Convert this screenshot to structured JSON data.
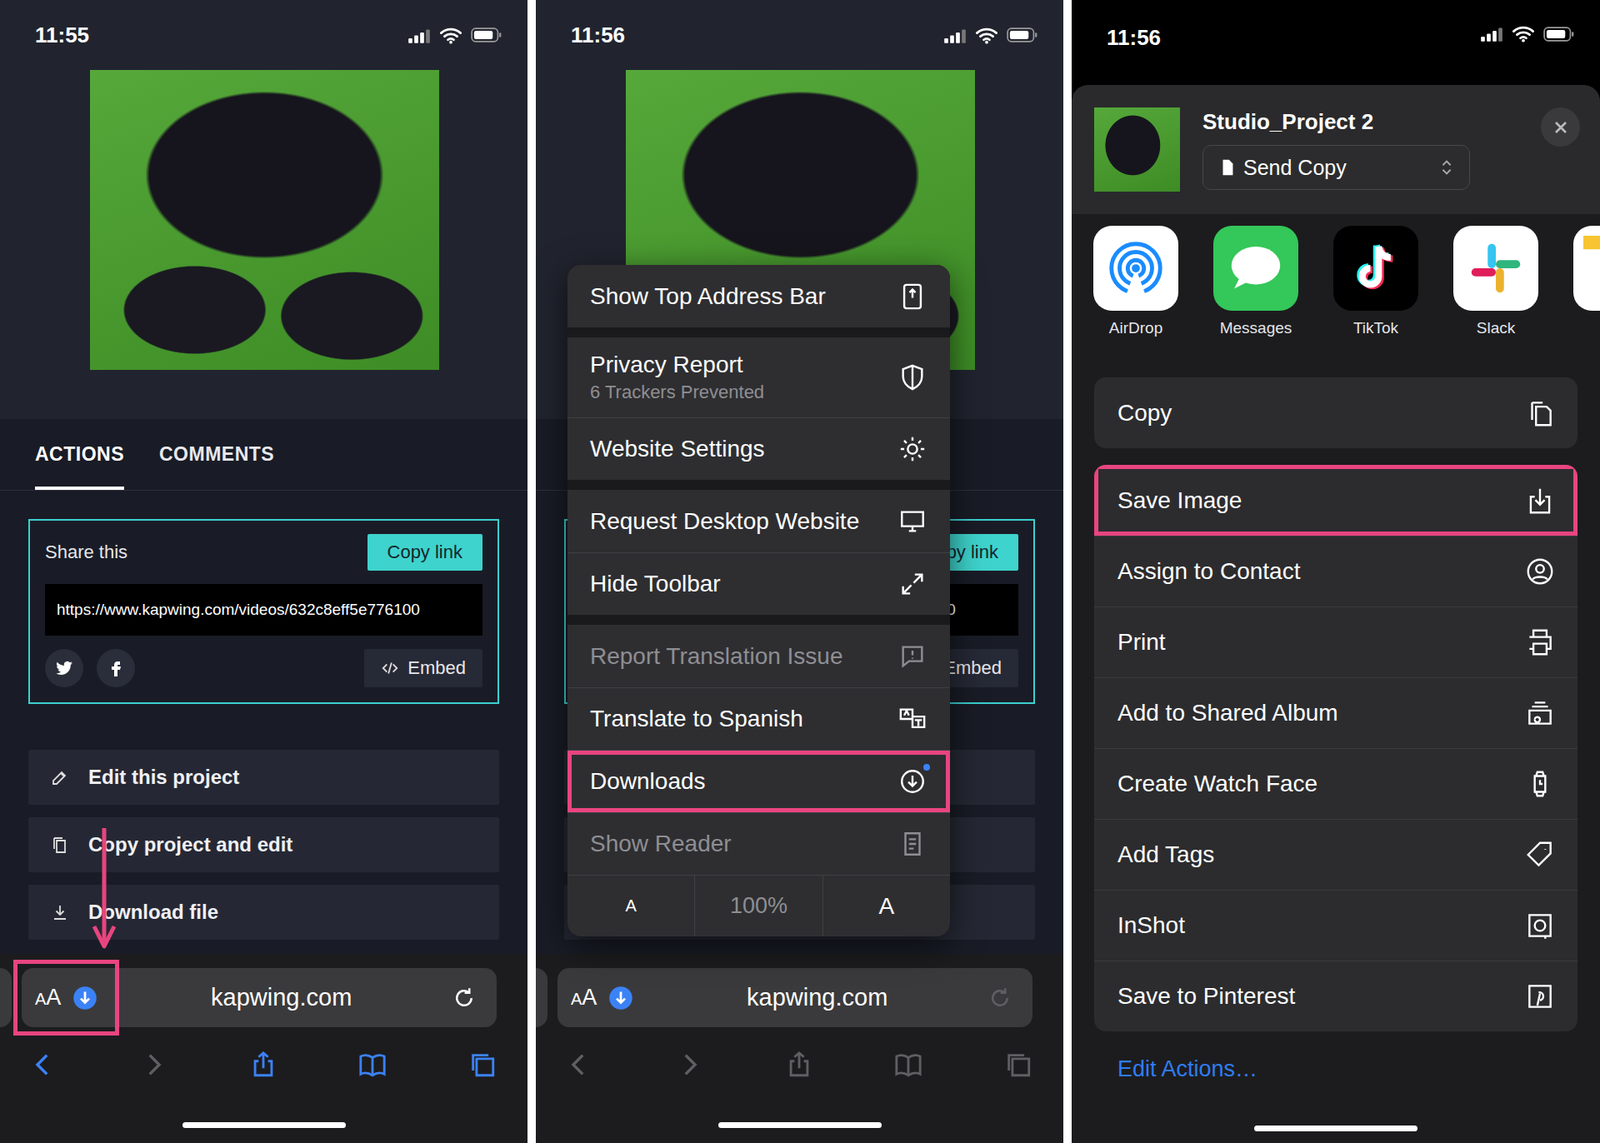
{
  "page": {
    "tabs": [
      {
        "label": "ACTIONS",
        "selected": true
      },
      {
        "label": "COMMENTS",
        "selected": false
      }
    ],
    "share": {
      "title": "Share this",
      "copy_button": "Copy link",
      "url": "https://www.kapwing.com/videos/632c8eff5e776100",
      "embed": "Embed"
    },
    "actions": [
      "Edit this project",
      "Copy project and edit",
      "Download file"
    ]
  },
  "address_bar": {
    "text_size_button": "AA",
    "domain": "kapwing.com",
    "download_active": true
  },
  "browser_screens": [
    {
      "time": "11:55",
      "toolbar_enabled": true,
      "aa_highlighted": true,
      "menu_open": false
    },
    {
      "time": "11:56",
      "toolbar_enabled": false,
      "aa_highlighted": false,
      "menu_open": true
    }
  ],
  "menu": {
    "groups": [
      [
        {
          "label": "Show Top Address Bar",
          "disabled": false,
          "highlighted": false
        }
      ],
      [
        {
          "label": "Privacy Report",
          "subtitle": "6 Trackers Prevented",
          "disabled": false,
          "highlighted": false
        },
        {
          "label": "Website Settings",
          "disabled": false,
          "highlighted": false
        }
      ],
      [
        {
          "label": "Request Desktop Website",
          "disabled": false,
          "highlighted": false
        },
        {
          "label": "Hide Toolbar",
          "disabled": false,
          "highlighted": false
        }
      ],
      [
        {
          "label": "Report Translation Issue",
          "disabled": true,
          "highlighted": false
        },
        {
          "label": "Translate to Spanish",
          "disabled": false,
          "highlighted": false
        },
        {
          "label": "Downloads",
          "disabled": false,
          "highlighted": true,
          "badge": true
        },
        {
          "label": "Show Reader",
          "disabled": true,
          "highlighted": false
        }
      ]
    ],
    "text_size": {
      "smaller": "A",
      "zoom": "100%",
      "larger": "A"
    }
  },
  "share_sheet": {
    "time": "11:56",
    "title": "Studio_Project 2",
    "mode": "Send Copy",
    "apps": [
      {
        "label": "AirDrop",
        "color": "#ffffff"
      },
      {
        "label": "Messages",
        "color": "#34c759"
      },
      {
        "label": "TikTok",
        "color": "#000000"
      },
      {
        "label": "Slack",
        "color": "#ffffff"
      },
      {
        "color": "#ffffff",
        "partial": true
      }
    ],
    "top_actions": [
      {
        "label": "Copy",
        "highlighted": false
      }
    ],
    "actions": [
      {
        "label": "Save Image",
        "highlighted": true
      },
      {
        "label": "Assign to Contact",
        "highlighted": false
      },
      {
        "label": "Print",
        "highlighted": false
      },
      {
        "label": "Add to Shared Album",
        "highlighted": false
      },
      {
        "label": "Create Watch Face",
        "highlighted": false
      },
      {
        "label": "Add Tags",
        "highlighted": false
      },
      {
        "label": "InShot",
        "highlighted": false
      },
      {
        "label": "Save to Pinterest",
        "highlighted": false
      }
    ],
    "edit": "Edit Actions…"
  }
}
